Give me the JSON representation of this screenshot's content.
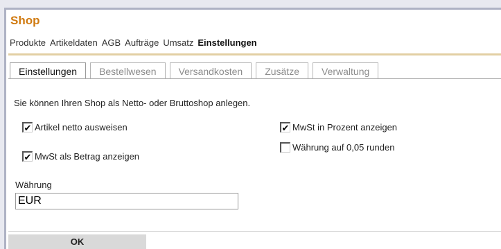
{
  "app": {
    "title": "Shop"
  },
  "nav": {
    "items": [
      {
        "label": "Produkte"
      },
      {
        "label": "Artikeldaten"
      },
      {
        "label": "AGB"
      },
      {
        "label": "Aufträge"
      },
      {
        "label": "Umsatz"
      },
      {
        "label": "Einstellungen",
        "active": true
      }
    ]
  },
  "tabs": [
    {
      "label": "Einstellungen",
      "active": true
    },
    {
      "label": "Bestellwesen"
    },
    {
      "label": "Versandkosten"
    },
    {
      "label": "Zusätze"
    },
    {
      "label": "Verwaltung"
    }
  ],
  "settings": {
    "description": "Sie können Ihren Shop als Netto- oder Bruttoshop anlegen.",
    "checkboxes": [
      {
        "label": "Artikel netto ausweisen",
        "checked": true
      },
      {
        "label": "MwSt als Betrag anzeigen",
        "checked": true
      },
      {
        "label": "MwSt in Prozent anzeigen",
        "checked": true
      },
      {
        "label": "Währung auf 0,05 runden",
        "checked": false
      }
    ],
    "currency": {
      "label": "Währung",
      "value": "EUR"
    },
    "ok_label": "OK"
  }
}
